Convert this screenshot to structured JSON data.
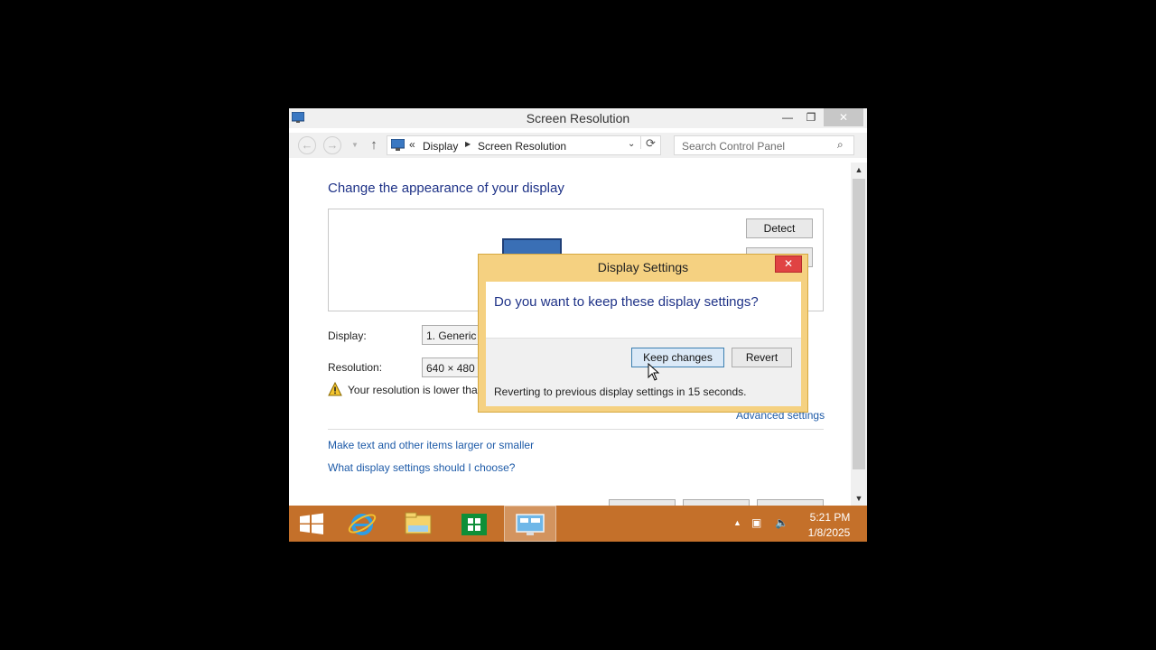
{
  "window": {
    "title": "Screen Resolution",
    "controls": {
      "minimize": "—",
      "maximize": "❐",
      "close": "✕"
    }
  },
  "nav": {
    "back_icon": "back-arrow-icon",
    "forward_icon": "forward-arrow-icon",
    "up_icon": "up-arrow-icon",
    "breadcrumb": {
      "chevron": "«",
      "item1": "Display",
      "separator": "▶",
      "item2": "Screen Resolution"
    },
    "search_placeholder": "Search Control Panel"
  },
  "main": {
    "heading": "Change the appearance of your display",
    "detect_label": "Detect",
    "display_label": "Display:",
    "display_value": "1. Generic Non-PnP Monitor",
    "resolution_label": "Resolution:",
    "resolution_value": "640 × 480",
    "warning_text": "Your resolution is lower than",
    "advanced_link": "Advanced settings",
    "link_text_size": "Make text and other items larger or smaller",
    "link_which_settings": "What display settings should I choose?"
  },
  "dialog": {
    "title": "Display Settings",
    "question": "Do you want to keep these display settings?",
    "keep_label": "Keep changes",
    "revert_label": "Revert",
    "countdown_text": "Reverting to previous display settings in 15 seconds.",
    "close_glyph": "✕"
  },
  "taskbar": {
    "items": [
      "start",
      "internet-explorer",
      "file-explorer",
      "store",
      "control-panel"
    ],
    "clock_time": "5:21 PM",
    "clock_date": "1/8/2025"
  },
  "colors": {
    "taskbar": "#c4702a",
    "dialog_frame": "#f5d181",
    "heading_blue": "#1e3287",
    "link_blue": "#1e5ba8",
    "close_red": "#e04343"
  }
}
